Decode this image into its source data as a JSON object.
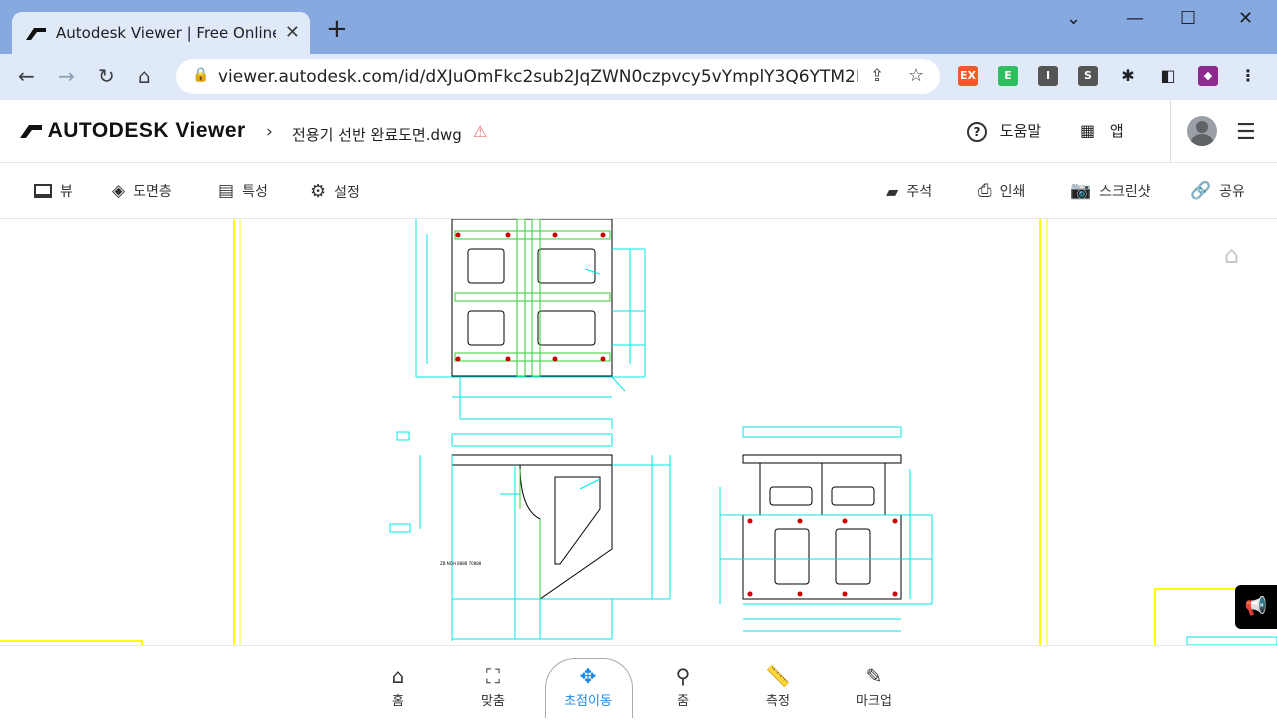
{
  "browser": {
    "tab_title": "Autodesk Viewer | Free Online F",
    "url": "viewer.autodesk.com/id/dXJuOmFkc2sub2JqZWN0czpvcy5vYmplY3Q6YTM2M..."
  },
  "header": {
    "logo": "AUTODESK Viewer",
    "file_name": "전용기 선반 완료도면.dwg",
    "help_label": "도움말",
    "apps_label": "앱"
  },
  "toolbar": {
    "left": [
      {
        "label": "뷰",
        "icon": "view-icon"
      },
      {
        "label": "도면층",
        "icon": "layers-icon"
      },
      {
        "label": "특성",
        "icon": "properties-icon"
      },
      {
        "label": "설정",
        "icon": "gear-icon"
      }
    ],
    "right": [
      {
        "label": "주석",
        "icon": "comment-icon"
      },
      {
        "label": "인쇄",
        "icon": "print-icon"
      },
      {
        "label": "스크린샷",
        "icon": "camera-icon"
      },
      {
        "label": "공유",
        "icon": "link-icon"
      }
    ]
  },
  "drawing": {
    "note": "ZB NOH 8888 70888"
  },
  "bottom_tools": [
    {
      "label": "홈",
      "icon": "home-icon"
    },
    {
      "label": "맞춤",
      "icon": "fit-icon"
    },
    {
      "label": "초점이동",
      "icon": "pan-icon",
      "active": true
    },
    {
      "label": "줌",
      "icon": "zoom-icon"
    },
    {
      "label": "측정",
      "icon": "measure-icon"
    },
    {
      "label": "마크업",
      "icon": "markup-icon"
    }
  ],
  "colors": {
    "chrome": "#86a9df",
    "accent": "#1e88e5",
    "cyan": "#00e5e5",
    "yellow": "#ffff00"
  }
}
